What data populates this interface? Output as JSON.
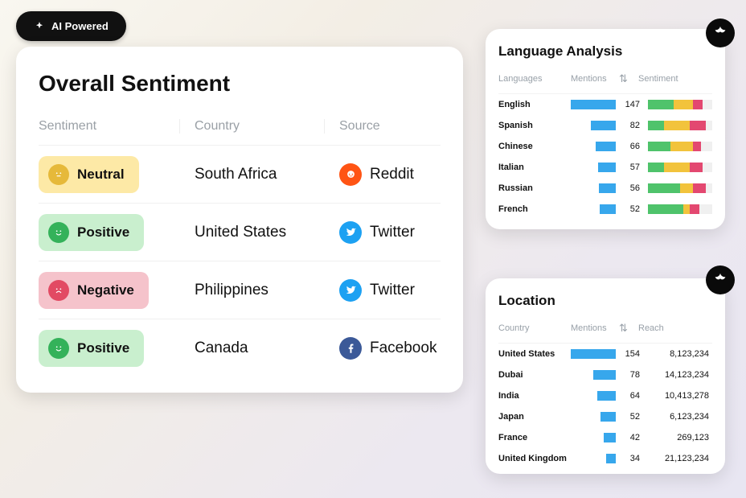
{
  "ai_label": "AI Powered",
  "sentiment_card": {
    "title": "Overall Sentiment",
    "headers": {
      "sentiment": "Sentiment",
      "country": "Country",
      "source": "Source"
    },
    "rows": [
      {
        "sentiment": "Neutral",
        "sentiment_key": "neutral",
        "country": "South Africa",
        "source": "Reddit",
        "source_key": "reddit"
      },
      {
        "sentiment": "Positive",
        "sentiment_key": "positive",
        "country": "United States",
        "source": "Twitter",
        "source_key": "twitter"
      },
      {
        "sentiment": "Negative",
        "sentiment_key": "negative",
        "country": "Philippines",
        "source": "Twitter",
        "source_key": "twitter"
      },
      {
        "sentiment": "Positive",
        "sentiment_key": "positive",
        "country": "Canada",
        "source": "Facebook",
        "source_key": "facebook"
      }
    ]
  },
  "language_card": {
    "title": "Language Analysis",
    "headers": {
      "lang": "Languages",
      "mentions": "Mentions",
      "sentiment": "Sentiment"
    },
    "max_mentions": 147,
    "rows": [
      {
        "language": "English",
        "mentions": 147,
        "pos": 40,
        "neu": 30,
        "neg": 15
      },
      {
        "language": "Spanish",
        "mentions": 82,
        "pos": 25,
        "neu": 40,
        "neg": 25
      },
      {
        "language": "Chinese",
        "mentions": 66,
        "pos": 35,
        "neu": 35,
        "neg": 12
      },
      {
        "language": "Italian",
        "mentions": 57,
        "pos": 25,
        "neu": 40,
        "neg": 20
      },
      {
        "language": "Russian",
        "mentions": 56,
        "pos": 50,
        "neu": 20,
        "neg": 20
      },
      {
        "language": "French",
        "mentions": 52,
        "pos": 55,
        "neu": 10,
        "neg": 15
      }
    ]
  },
  "location_card": {
    "title": "Location",
    "headers": {
      "country": "Country",
      "mentions": "Mentions",
      "reach": "Reach"
    },
    "max_mentions": 154,
    "rows": [
      {
        "country": "United States",
        "mentions": 154,
        "reach": "8,123,234"
      },
      {
        "country": "Dubai",
        "mentions": 78,
        "reach": "14,123,234"
      },
      {
        "country": "India",
        "mentions": 64,
        "reach": "10,413,278"
      },
      {
        "country": "Japan",
        "mentions": 52,
        "reach": "6,123,234"
      },
      {
        "country": "France",
        "mentions": 42,
        "reach": "269,123"
      },
      {
        "country": "United Kingdom",
        "mentions": 34,
        "reach": "21,123,234"
      }
    ]
  }
}
